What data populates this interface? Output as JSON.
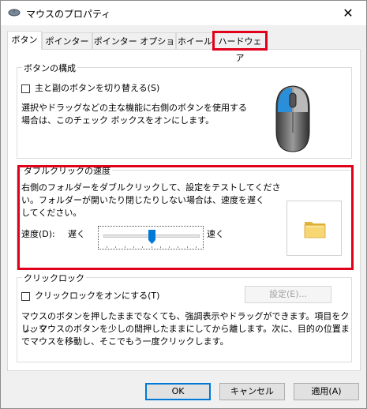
{
  "window": {
    "title": "マウスのプロパティ",
    "close_symbol": "✕"
  },
  "tabs": [
    {
      "label": "ボタン",
      "active": true
    },
    {
      "label": "ポインター"
    },
    {
      "label": "ポインター オプション"
    },
    {
      "label": "ホイール"
    },
    {
      "label": "ハードウェア",
      "highlighted": true
    }
  ],
  "button_config": {
    "group_title": "ボタンの構成",
    "checkbox_label": "主と副のボタンを切り替える(S)",
    "checkbox_checked": false,
    "description_line1": "選択やドラッグなどの主な機能に右側のボタンを使用する",
    "description_line2": "場合は、このチェック ボックスをオンにします。"
  },
  "double_click": {
    "group_title": "ダブルクリックの速度",
    "description_line1": "右側のフォルダーをダブルクリックして、設定をテストしてくださ",
    "description_line2": "い。フォルダーが開いたり閉じたりしない場合は、速度を遅く",
    "description_line3": "してください。",
    "speed_label": "速度(D):",
    "slow_label": "遅く",
    "fast_label": "速く",
    "slider_value": 0.5,
    "folder_icon": "folder-icon"
  },
  "click_lock": {
    "group_title": "クリックロック",
    "checkbox_label": "クリックロックをオンにする(T)",
    "checkbox_checked": false,
    "settings_button": "設定(E)...",
    "description_line1": "マウスのボタンを押したままでなくても、強調表示やドラッグができます。項目をクリック",
    "description_line2": "し、マウスのボタンを少しの間押したままにしてから離します。次に、目的の位置ま",
    "description_line3": "でマウスを移動し、そこでもう一度クリックします。"
  },
  "footer": {
    "ok": "OK",
    "cancel": "キャンセル",
    "apply": "適用(A)"
  },
  "colors": {
    "highlight": "#e0001b",
    "accent": "#0078d7",
    "mouse_button": "#2a8fd8"
  }
}
